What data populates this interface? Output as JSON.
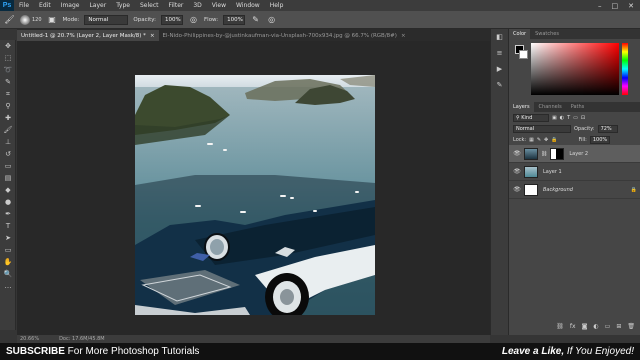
{
  "app": {
    "logo": "Ps"
  },
  "menu": [
    "File",
    "Edit",
    "Image",
    "Layer",
    "Type",
    "Select",
    "Filter",
    "3D",
    "View",
    "Window",
    "Help"
  ],
  "window_controls": [
    "–",
    "□",
    "✕"
  ],
  "options": {
    "brush_size": "120",
    "mode_label": "Mode:",
    "mode_value": "Normal",
    "opacity_label": "Opacity:",
    "opacity_value": "100%",
    "flow_label": "Flow:",
    "flow_value": "100%"
  },
  "tabs": [
    {
      "label": "Untitled-1 @ 20.7% (Layer 2, Layer Mask/8) *",
      "close": "×"
    },
    {
      "label": "El-Nido-Philippines-by-@justinkaufman-via-Unsplash-700x934.jpg @ 66.7% (RGB/8#)",
      "close": "×"
    }
  ],
  "status": {
    "zoom": "20.66%",
    "doc": "Doc: 17.6M/45.8M"
  },
  "color_panel": {
    "tabs": [
      "Color",
      "Swatches"
    ]
  },
  "layers_panel": {
    "tabs": [
      "Layers",
      "Channels",
      "Paths"
    ],
    "kind_label": "Kind",
    "blend_mode": "Normal",
    "opacity_label": "Opacity:",
    "opacity_value": "72%",
    "lock_label": "Lock:",
    "fill_label": "Fill:",
    "fill_value": "100%",
    "layers": [
      {
        "name": "Layer 2",
        "selected": true
      },
      {
        "name": "Layer 1",
        "selected": false
      },
      {
        "name": "Background",
        "selected": false,
        "locked": true
      }
    ],
    "footer_icons": [
      "link-icon",
      "fx-icon",
      "mask-icon",
      "adjustment-icon",
      "group-icon",
      "new-layer-icon",
      "trash-icon"
    ]
  },
  "banner": {
    "left_bold": "SUBSCRIBE",
    "left_rest": " For More Photoshop Tutorials",
    "right_bold": "Leave a Like,",
    "right_rest": " If You Enjoyed!"
  },
  "colors": {
    "foreground": "#000000",
    "background": "#ffffff",
    "accent": "#2fa3f5"
  }
}
